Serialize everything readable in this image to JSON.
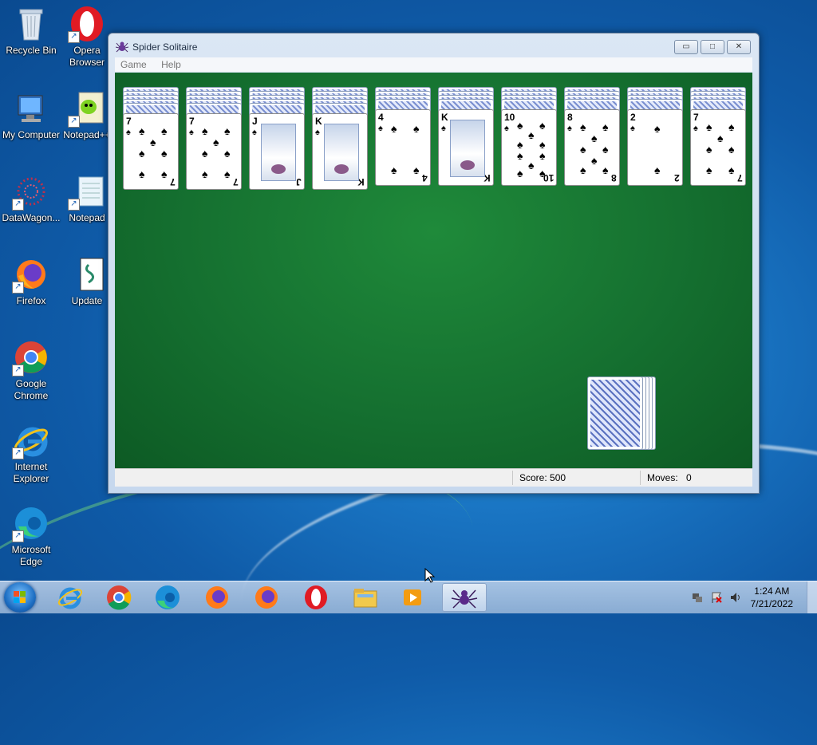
{
  "desktop": {
    "icons": [
      {
        "label": "Recycle Bin"
      },
      {
        "label": "Opera Browser"
      },
      {
        "label": "My Computer"
      },
      {
        "label": "Notepad++"
      },
      {
        "label": "DataWagon..."
      },
      {
        "label": "Notepad"
      },
      {
        "label": "Firefox"
      },
      {
        "label": "Update"
      },
      {
        "label": "Google Chrome"
      },
      {
        "label": "Internet Explorer"
      },
      {
        "label": "Microsoft Edge"
      }
    ]
  },
  "window": {
    "title": "Spider Solitaire",
    "menu": [
      "Game",
      "Help"
    ],
    "buttons": {
      "minimize": "▭",
      "maximize": "□",
      "close": "✕"
    }
  },
  "game": {
    "columns": [
      {
        "hidden": 5,
        "top_rank": "7",
        "suit": "♠"
      },
      {
        "hidden": 5,
        "top_rank": "7",
        "suit": "♠"
      },
      {
        "hidden": 5,
        "top_rank": "J",
        "suit": "♠"
      },
      {
        "hidden": 5,
        "top_rank": "K",
        "suit": "♠"
      },
      {
        "hidden": 4,
        "top_rank": "4",
        "suit": "♠"
      },
      {
        "hidden": 4,
        "top_rank": "K",
        "suit": "♠"
      },
      {
        "hidden": 4,
        "top_rank": "10",
        "suit": "♠"
      },
      {
        "hidden": 4,
        "top_rank": "8",
        "suit": "♠"
      },
      {
        "hidden": 4,
        "top_rank": "2",
        "suit": "♠"
      },
      {
        "hidden": 4,
        "top_rank": "7",
        "suit": "♠"
      }
    ],
    "stock_piles": 5
  },
  "status": {
    "score_label": "Score: 500",
    "moves_label": "Moves:",
    "moves_value": "0"
  },
  "taskbar": {
    "items": [
      "Internet Explorer",
      "Google Chrome",
      "Microsoft Edge",
      "Firefox",
      "Firefox",
      "Opera",
      "File Explorer",
      "Media Player",
      "Spider Solitaire"
    ],
    "clock_time": "1:24 AM",
    "clock_date": "7/21/2022"
  }
}
